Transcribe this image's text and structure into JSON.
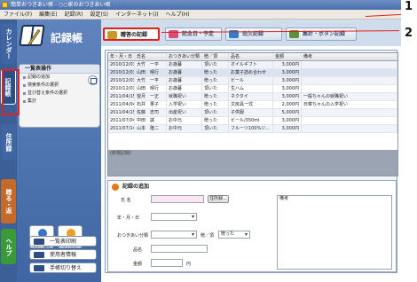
{
  "window": {
    "title": "簡単おつきあい帳 - ○○家のおつきあい帳"
  },
  "menu": [
    "ファイル(F)",
    "編集(E)",
    "記録(R)",
    "設定(S)",
    "インターネット(I)",
    "ヘルプ(H)"
  ],
  "vtabs": [
    {
      "label": "カレンダー",
      "color": "#3f66a2"
    },
    {
      "label": "記録帳",
      "color": "#2d4e86",
      "active": true
    },
    {
      "label": "住所録",
      "color": "#3f66a2"
    },
    {
      "label": "贈る・返",
      "color": "#c46a2a"
    },
    {
      "label": "ヘルプ",
      "color": "#3a9a3a"
    }
  ],
  "sidebar": {
    "title": "記録帳",
    "panel_title": "一覧表操作",
    "items": [
      "記録の追加",
      "検索条件の選択",
      "並び替え条件の選択",
      "集計"
    ],
    "square_buttons": [
      {
        "label": "おつきあい\nマナー事典",
        "color": "#3a74c8"
      },
      {
        "label": "ライフイベ\nントメモ",
        "color": "#e8a020"
      }
    ],
    "buttons": [
      "一覧表印刷",
      "使用者情報",
      "手帳切り替え"
    ]
  },
  "toolbar": {
    "tabs": [
      {
        "label": "贈答の記録",
        "active": true,
        "color": "#c89a2a"
      },
      {
        "label": "記念日・予定",
        "active": false,
        "color": "#d84e7a"
      },
      {
        "label": "出欠記録",
        "active": false,
        "color": "#2e7fd1"
      },
      {
        "label": "集計・ボタン記録",
        "active": false,
        "color": "#5c8f3a"
      }
    ]
  },
  "table": {
    "columns": [
      "年・月・日",
      "氏名",
      "おつきあい分類",
      "贈／頂",
      "品名",
      "金額",
      "備考"
    ],
    "rows": [
      [
        "2010/12/03",
        "大竹　一平",
        "お歳暮",
        "頂いた",
        "オイルギフト",
        "3,000円",
        ""
      ],
      [
        "2010/12/03",
        "山田　晴行",
        "お歳暮",
        "贈った",
        "お菓子詰め合わせ",
        "3,000円",
        ""
      ],
      [
        "2010/12/03",
        "大竹　一平",
        "お歳暮",
        "贈った",
        "ビール",
        "3,000円",
        ""
      ],
      [
        "2010/12/03",
        "山田　晴行",
        "お歳暮",
        "頂いた",
        "生ハム",
        "3,000円",
        ""
      ],
      [
        "2011/04/15",
        "望月　一正",
        "就職祝い",
        "贈った",
        "ネクタイ",
        "3,000円",
        "一般ちゃんの就職祝い"
      ],
      [
        "2011/04/04",
        "石井　果子",
        "入学祝い",
        "贈った",
        "文房具一式",
        "2,000円",
        "日菜ちゃんの入学祝い"
      ],
      [
        "2011/04/15",
        "佐藤　忠司",
        "出産祝い",
        "頂いた",
        "子供服",
        "5,000円",
        ""
      ],
      [
        "2011/07/04",
        "中田　誠",
        "お中元",
        "贈った",
        "ビール/350ml",
        "3,000円",
        ""
      ],
      [
        "2011/07/14",
        "山本　隆二",
        "お中元",
        "頂いた",
        "フルーツ100%ジ...",
        "3,000円",
        ""
      ]
    ],
    "new_row": "(新規記録)"
  },
  "form": {
    "title": "記録の追加",
    "name_label": "氏 名",
    "address_book_button": "住所録...",
    "date_label": "年・月・日",
    "category_label": "おつきあい分類",
    "give_receive_label": "贈／頂",
    "give_receive_value": "贈った",
    "item_label": "品名",
    "amount_label": "金額",
    "amount_unit": "円",
    "notes_label": "備考"
  },
  "annotations": [
    "1",
    "2"
  ],
  "colors": {
    "highlight": "#e3201b",
    "accent": "#3f66a2"
  }
}
